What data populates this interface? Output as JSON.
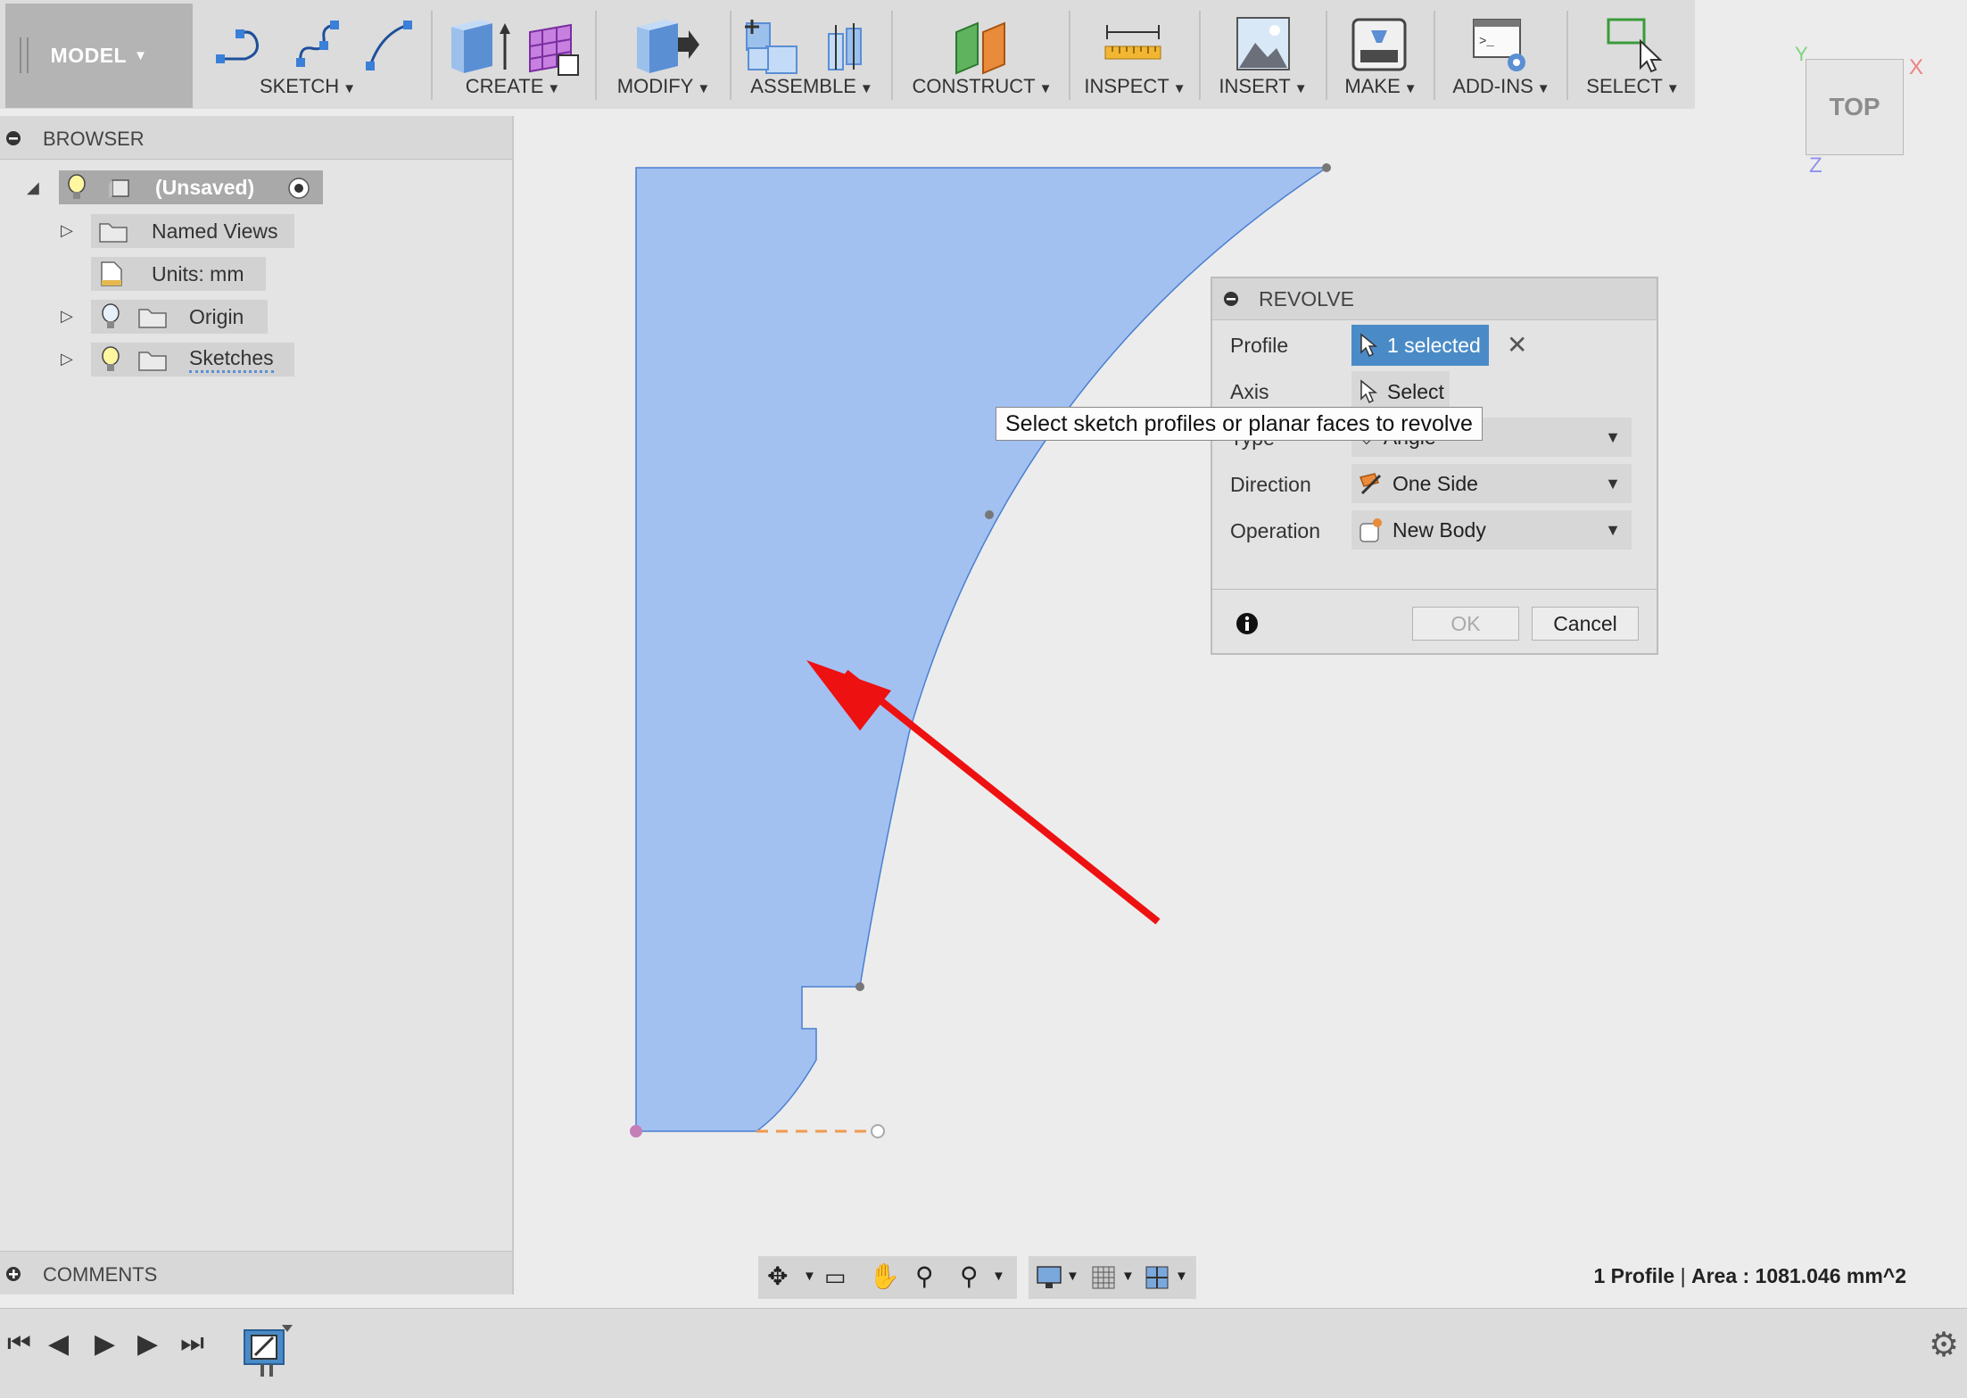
{
  "toolbar": {
    "workspace": "MODEL",
    "groups": [
      {
        "label": "SKETCH"
      },
      {
        "label": "CREATE"
      },
      {
        "label": "MODIFY"
      },
      {
        "label": "ASSEMBLE"
      },
      {
        "label": "CONSTRUCT"
      },
      {
        "label": "INSPECT"
      },
      {
        "label": "INSERT"
      },
      {
        "label": "MAKE"
      },
      {
        "label": "ADD-INS"
      },
      {
        "label": "SELECT"
      }
    ]
  },
  "browser": {
    "title": "BROWSER",
    "root": "(Unsaved)",
    "items": [
      {
        "label": "Named Views"
      },
      {
        "label": "Units: mm"
      },
      {
        "label": "Origin"
      },
      {
        "label": "Sketches"
      }
    ]
  },
  "comments": {
    "title": "COMMENTS"
  },
  "viewcube": {
    "face": "TOP",
    "axis_x": "X",
    "axis_y": "Y",
    "axis_z": "Z"
  },
  "revolve": {
    "title": "REVOLVE",
    "profile_label": "Profile",
    "profile_value": "1 selected",
    "axis_label": "Axis",
    "axis_value": "Select",
    "type_label": "Type",
    "type_value": "Angle",
    "direction_label": "Direction",
    "direction_value": "One Side",
    "operation_label": "Operation",
    "operation_value": "New Body",
    "ok": "OK",
    "cancel": "Cancel"
  },
  "tooltip": "Select sketch profiles or planar faces to revolve",
  "status": {
    "profile": "1 Profile",
    "separator": "|",
    "area": "Area : 1081.046 mm^2"
  },
  "colors": {
    "profile_fill": "#a2c1f1",
    "profile_edge": "#4a7fd0",
    "arrow": "#ee1111",
    "selected_btn": "#4a8bc7"
  }
}
